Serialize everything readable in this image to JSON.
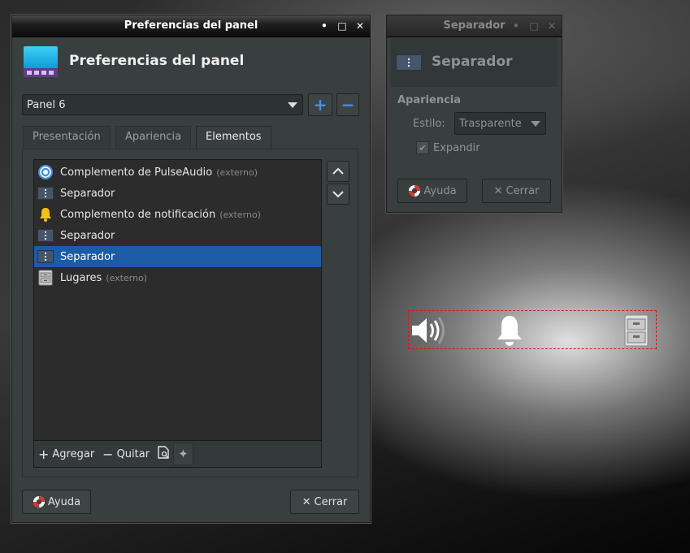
{
  "main_window": {
    "title": "Preferencias del panel",
    "header": "Preferencias del panel",
    "panel_select": "Panel 6",
    "add_panel": "+",
    "remove_panel": "−",
    "tabs": [
      "Presentación",
      "Apariencia",
      "Elementos"
    ],
    "active_tab": "Elementos",
    "items": [
      {
        "label": "Complemento de PulseAudio",
        "extra": "(externo)",
        "icon": "pulseaudio-icon"
      },
      {
        "label": "Separador",
        "extra": "",
        "icon": "separator-icon"
      },
      {
        "label": "Complemento de notificación",
        "extra": "(externo)",
        "icon": "bell-icon"
      },
      {
        "label": "Separador",
        "extra": "",
        "icon": "separator-icon"
      },
      {
        "label": "Separador",
        "extra": "",
        "icon": "separator-icon",
        "selected": true
      },
      {
        "label": "Lugares",
        "extra": "(externo)",
        "icon": "places-icon"
      }
    ],
    "toolbar": {
      "add": "Agregar",
      "remove": "Quitar"
    },
    "help": "Ayuda",
    "close": "Cerrar"
  },
  "sep_window": {
    "title": "Separador",
    "header": "Separador",
    "section": "Apariencia",
    "style_label": "Estilo:",
    "style_value": "Trasparente",
    "expand_label": "Expandir",
    "expand_checked": true,
    "help": "Ayuda",
    "close": "Cerrar"
  },
  "colors": {
    "selection": "#1c5ba6",
    "accent": "#4a90e2"
  }
}
